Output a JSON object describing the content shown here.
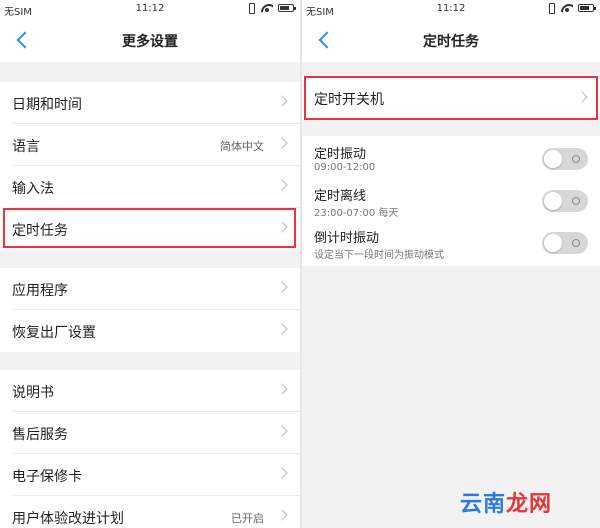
{
  "left_screen": {
    "status": {
      "carrier": "无SIM",
      "time": "11:12"
    },
    "header_title": "更多设置",
    "groups": [
      [
        {
          "label": "日期和时间",
          "value": ""
        },
        {
          "label": "语言",
          "value": "简体中文"
        },
        {
          "label": "输入法",
          "value": ""
        },
        {
          "label": "定时任务",
          "value": ""
        }
      ],
      [
        {
          "label": "应用程序",
          "value": ""
        },
        {
          "label": "恢复出厂设置",
          "value": ""
        }
      ],
      [
        {
          "label": "说明书",
          "value": ""
        },
        {
          "label": "售后服务",
          "value": ""
        },
        {
          "label": "电子保修卡",
          "value": ""
        },
        {
          "label": "用户体验改进计划",
          "value": "已开启"
        }
      ]
    ]
  },
  "right_screen": {
    "status": {
      "carrier": "无SIM",
      "time": "11:12"
    },
    "header_title": "定时任务",
    "power_row": {
      "label": "定时开关机"
    },
    "toggles": [
      {
        "label": "定时振动",
        "sub": "09:00-12:00",
        "on": false
      },
      {
        "label": "定时离线",
        "sub": "23:00-07:00 每天",
        "on": false
      },
      {
        "label": "倒计时振动",
        "sub": "设定当下一段时间为振动模式",
        "on": false
      }
    ]
  },
  "colors": {
    "accent": "#2a8ce8",
    "highlight": "#e8343a",
    "toggle_off": "#d7d7d7"
  },
  "watermark": {
    "part_a": "云南",
    "part_b": "龙网"
  }
}
